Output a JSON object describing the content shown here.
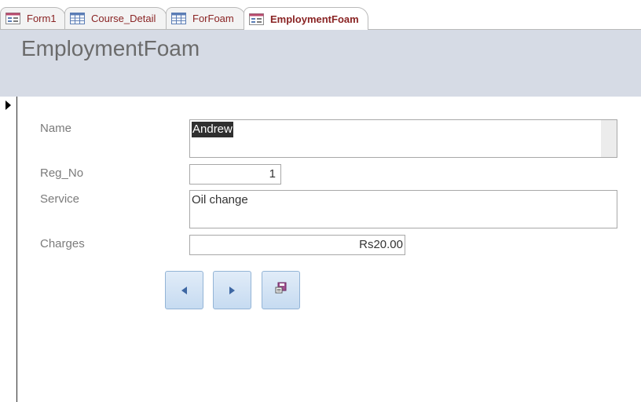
{
  "tabs": [
    {
      "label": "Form1",
      "icon": "form-icon",
      "active": false
    },
    {
      "label": "Course_Detail",
      "icon": "table-icon",
      "active": false
    },
    {
      "label": "ForFoam",
      "icon": "table-icon",
      "active": false
    },
    {
      "label": "EmploymentFoam",
      "icon": "form-icon",
      "active": true
    }
  ],
  "form": {
    "title": "EmploymentFoam",
    "fields": {
      "name": {
        "label": "Name",
        "value": "Andrew"
      },
      "reg_no": {
        "label": "Reg_No",
        "value": "1"
      },
      "service": {
        "label": "Service",
        "value": "Oil change"
      },
      "charges": {
        "label": "Charges",
        "value": "Rs20.00"
      }
    }
  },
  "buttons": {
    "previous": {
      "icon": "previous-record-icon"
    },
    "next": {
      "icon": "next-record-icon"
    },
    "save": {
      "icon": "save-record-icon"
    }
  },
  "colors": {
    "header_bg": "#d6dbe5",
    "tab_text": "#8a2424",
    "button_border": "#93b4d6"
  }
}
